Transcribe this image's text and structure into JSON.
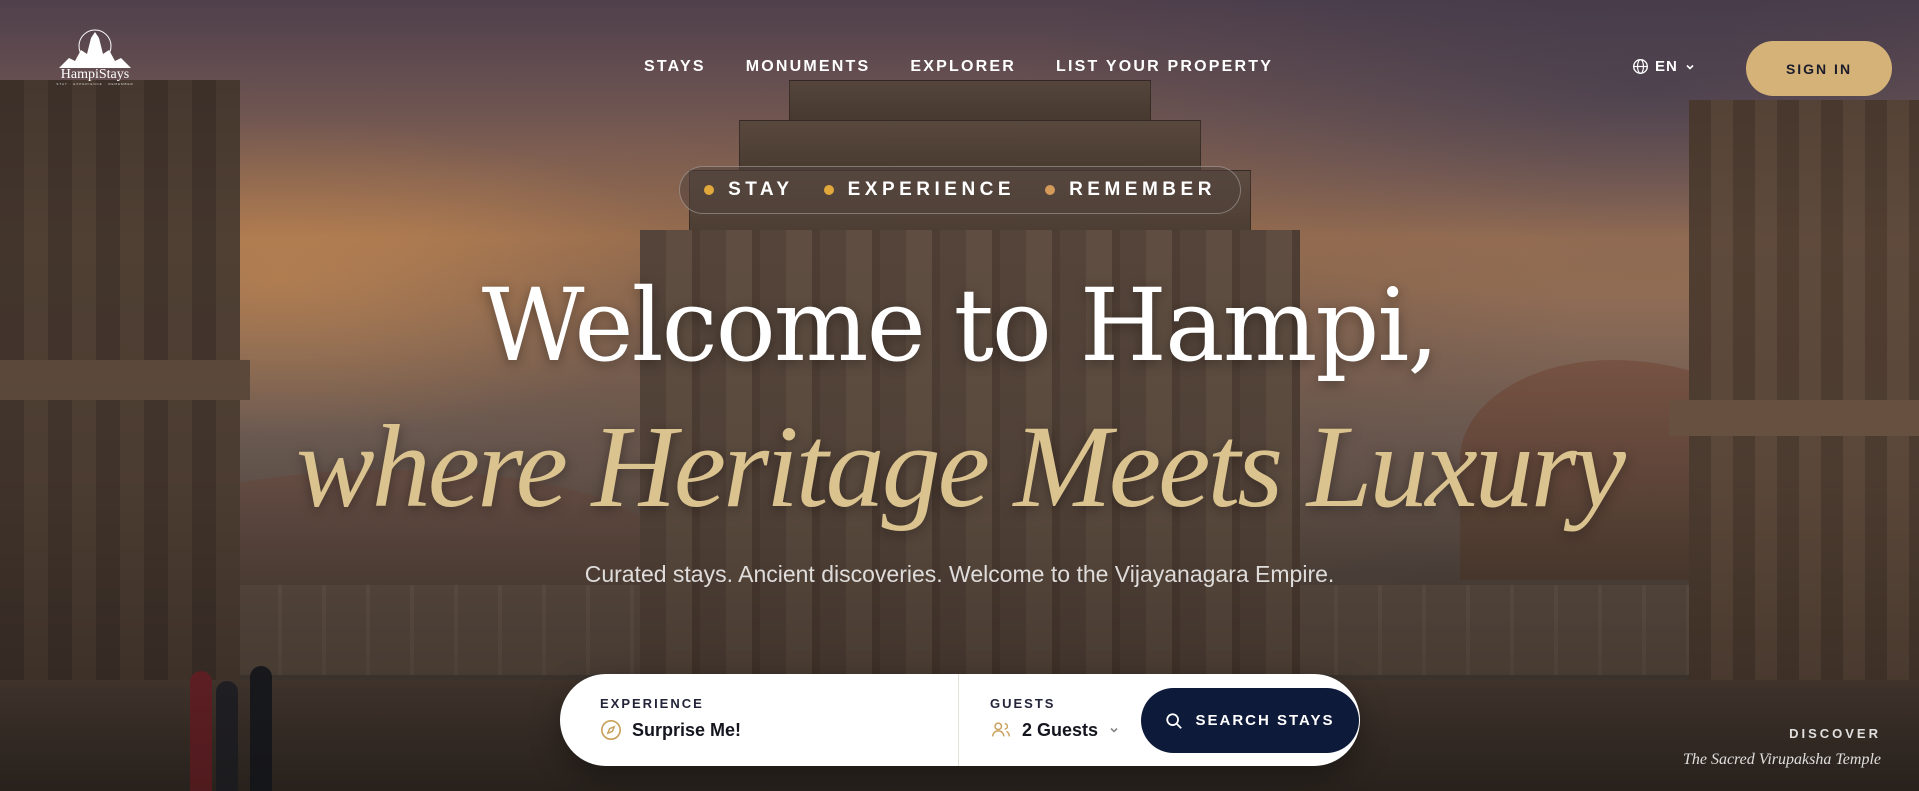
{
  "brand": {
    "name": "HampiStays",
    "tagline": "STAY · EXPERIENCE · REMEMBER",
    "logo_icon": "temple-silhouette-logo"
  },
  "nav": {
    "items": [
      "STAYS",
      "MONUMENTS",
      "EXPLORER",
      "LIST YOUR PROPERTY"
    ]
  },
  "language": {
    "value": "EN",
    "icon": "globe-icon"
  },
  "signin": {
    "label": "SIGN IN"
  },
  "pill": {
    "items": [
      "STAY",
      "EXPERIENCE",
      "REMEMBER"
    ]
  },
  "hero": {
    "line1": "Welcome to Hampi,",
    "line2": "where Heritage Meets Luxury",
    "subtitle": "Curated stays. Ancient discoveries. Welcome to the Vijayanagara Empire."
  },
  "search": {
    "experience_label": "EXPERIENCE",
    "experience_value": "Surprise Me!",
    "guests_label": "GUESTS",
    "guests_value": "2 Guests",
    "button_label": "SEARCH STAYS"
  },
  "discover": {
    "kicker": "DISCOVER",
    "title": "The Sacred Virupaksha Temple"
  },
  "colors": {
    "accent_gold": "#d4b278",
    "navy": "#0e1a3a",
    "dot": "#e2a83c"
  }
}
